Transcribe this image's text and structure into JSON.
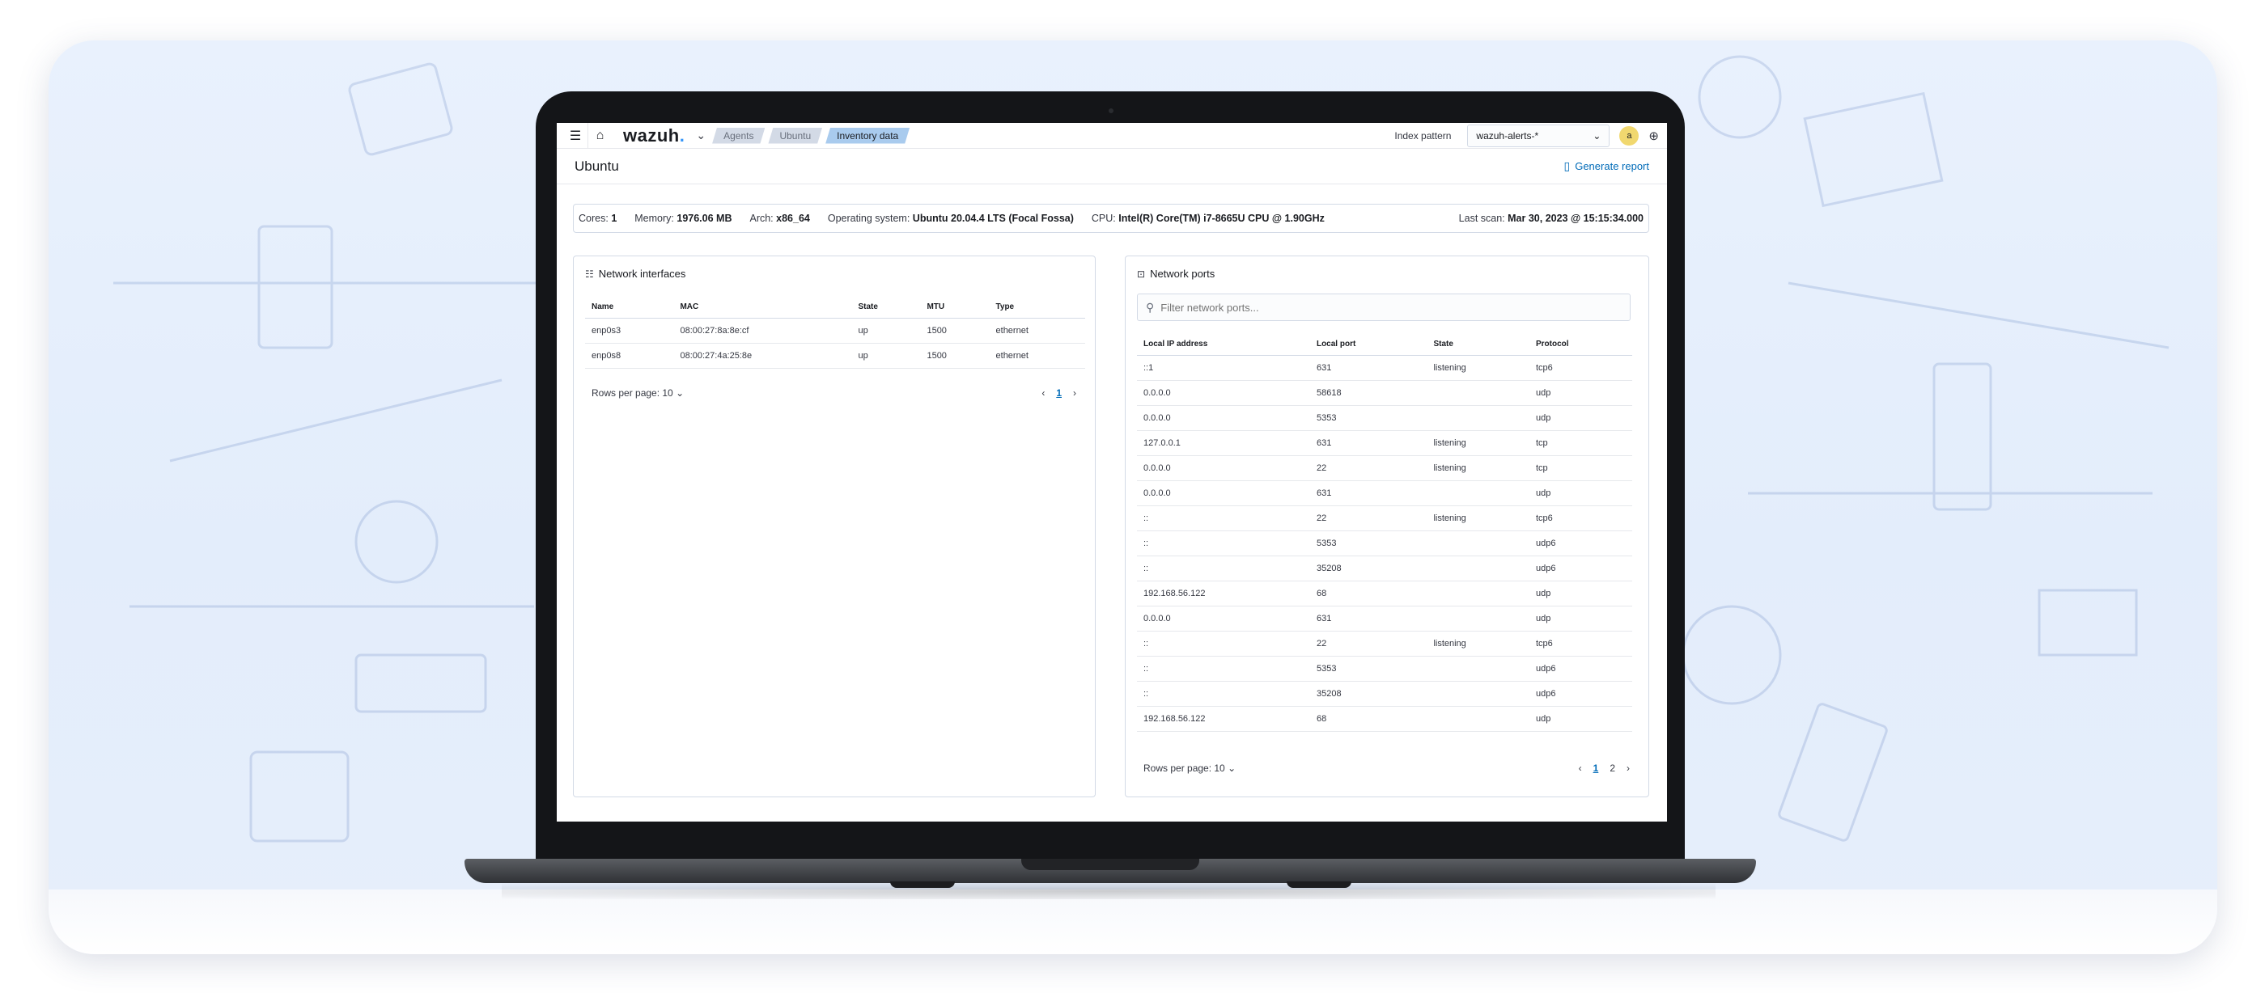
{
  "topbar": {
    "menu_icon": "menu-icon",
    "home_icon": "home-icon",
    "logo": "wazuh",
    "logo_dot": ".",
    "breadcrumbs": [
      "Agents",
      "Ubuntu",
      "Inventory data"
    ],
    "index_pattern_label": "Index pattern",
    "index_pattern_value": "wazuh-alerts-*",
    "avatar_letter": "a"
  },
  "header": {
    "title": "Ubuntu",
    "generate_report": "Generate report"
  },
  "agent_info": {
    "cores_label": "Cores:",
    "cores": "1",
    "memory_label": "Memory:",
    "memory": "1976.06 MB",
    "arch_label": "Arch:",
    "arch": "x86_64",
    "os_label": "Operating system:",
    "os": "Ubuntu 20.04.4 LTS (Focal Fossa)",
    "cpu_label": "CPU:",
    "cpu": "Intel(R) Core(TM) i7-8665U CPU @ 1.90GHz",
    "last_scan_label": "Last scan:",
    "last_scan": "Mar 30, 2023 @ 15:15:34.000"
  },
  "network_interfaces": {
    "title": "Network interfaces",
    "columns": [
      "Name",
      "MAC",
      "State",
      "MTU",
      "Type"
    ],
    "rows": [
      [
        "enp0s3",
        "08:00:27:8a:8e:cf",
        "up",
        "1500",
        "ethernet"
      ],
      [
        "enp0s8",
        "08:00:27:4a:25:8e",
        "up",
        "1500",
        "ethernet"
      ]
    ],
    "rows_per_page": "Rows per page: 10",
    "pages": [
      "1"
    ],
    "current_page": "1"
  },
  "network_ports": {
    "title": "Network ports",
    "search_placeholder": "Filter network ports...",
    "columns": [
      "Local IP address",
      "Local port",
      "State",
      "Protocol"
    ],
    "rows": [
      [
        "::1",
        "631",
        "listening",
        "tcp6"
      ],
      [
        "0.0.0.0",
        "58618",
        "",
        "udp"
      ],
      [
        "0.0.0.0",
        "5353",
        "",
        "udp"
      ],
      [
        "127.0.0.1",
        "631",
        "listening",
        "tcp"
      ],
      [
        "0.0.0.0",
        "22",
        "listening",
        "tcp"
      ],
      [
        "0.0.0.0",
        "631",
        "",
        "udp"
      ],
      [
        "::",
        "22",
        "listening",
        "tcp6"
      ],
      [
        "::",
        "5353",
        "",
        "udp6"
      ],
      [
        "::",
        "35208",
        "",
        "udp6"
      ],
      [
        "192.168.56.122",
        "68",
        "",
        "udp"
      ],
      [
        "0.0.0.0",
        "631",
        "",
        "udp"
      ],
      [
        "::",
        "22",
        "listening",
        "tcp6"
      ],
      [
        "::",
        "5353",
        "",
        "udp6"
      ],
      [
        "::",
        "35208",
        "",
        "udp6"
      ],
      [
        "192.168.56.122",
        "68",
        "",
        "udp"
      ]
    ],
    "rows_per_page": "Rows per page: 10",
    "pages": [
      "1",
      "2"
    ],
    "current_page": "1"
  }
}
